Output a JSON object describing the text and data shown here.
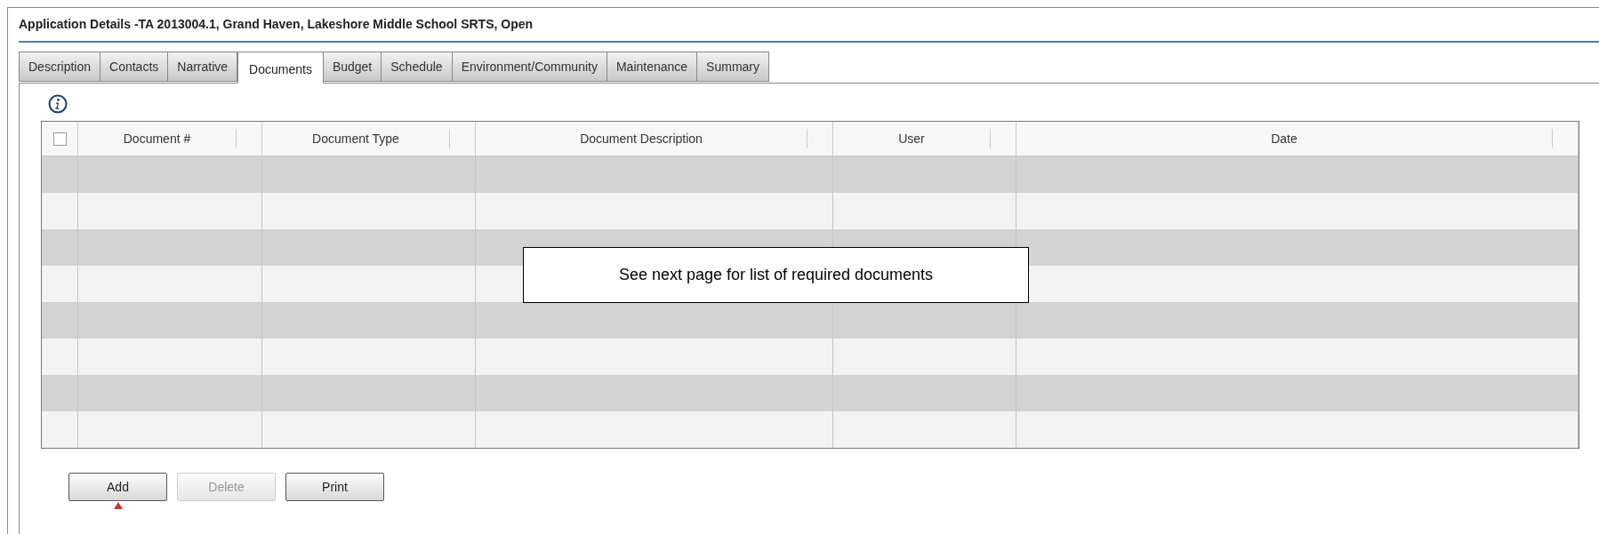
{
  "title": "Application Details -TA 2013004.1, Grand Haven, Lakeshore Middle School SRTS, Open",
  "tabs": [
    {
      "label": "Description",
      "selected": false
    },
    {
      "label": "Contacts",
      "selected": false
    },
    {
      "label": "Narrative",
      "selected": false
    },
    {
      "label": "Documents",
      "selected": true
    },
    {
      "label": "Budget",
      "selected": false
    },
    {
      "label": "Schedule",
      "selected": false
    },
    {
      "label": "Environment/Community",
      "selected": false
    },
    {
      "label": "Maintenance",
      "selected": false
    },
    {
      "label": "Summary",
      "selected": false
    }
  ],
  "table": {
    "select_all": {
      "checked": false
    },
    "columns": [
      "Document #",
      "Document Type",
      "Document Description",
      "User",
      "Date"
    ]
  },
  "callout": "See next page for list of required documents",
  "buttons": [
    {
      "label": "Add",
      "disabled": false
    },
    {
      "label": "Delete",
      "disabled": true
    },
    {
      "label": "Print",
      "disabled": false
    }
  ]
}
